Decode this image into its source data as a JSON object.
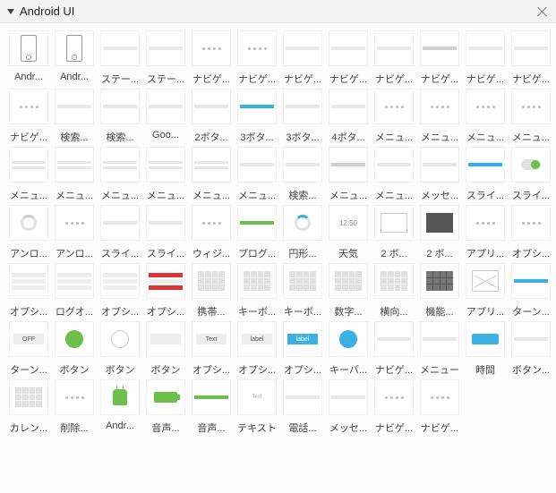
{
  "header": {
    "title": "Android UI"
  },
  "items": [
    {
      "label": "Andr...",
      "t": "phone"
    },
    {
      "label": "Andr...",
      "t": "phone"
    },
    {
      "label": "ステー...",
      "t": "bar"
    },
    {
      "label": "ステー...",
      "t": "bar"
    },
    {
      "label": "ナビゲ...",
      "t": "dots"
    },
    {
      "label": "ナビゲ...",
      "t": "dots"
    },
    {
      "label": "ナビゲ...",
      "t": "bar"
    },
    {
      "label": "ナビゲ...",
      "t": "bar"
    },
    {
      "label": "ナビゲ...",
      "t": "bar"
    },
    {
      "label": "ナビゲ...",
      "t": "bar-d"
    },
    {
      "label": "ナビゲ...",
      "t": "bar"
    },
    {
      "label": "ナビゲ...",
      "t": "bar"
    },
    {
      "label": "ナビゲ...",
      "t": "dots"
    },
    {
      "label": "検索...",
      "t": "bar"
    },
    {
      "label": "検索...",
      "t": "bar"
    },
    {
      "label": "Goo...",
      "t": "bar"
    },
    {
      "label": "2ボタ...",
      "t": "bar"
    },
    {
      "label": "3ボタ...",
      "t": "bar-b"
    },
    {
      "label": "3ボタ...",
      "t": "bar"
    },
    {
      "label": "4ボタ...",
      "t": "bar"
    },
    {
      "label": "メニュ...",
      "t": "dots"
    },
    {
      "label": "メニュ...",
      "t": "dots"
    },
    {
      "label": "メニュ...",
      "t": "dots"
    },
    {
      "label": "メニュ...",
      "t": "dots"
    },
    {
      "label": "メニュ...",
      "t": "2line"
    },
    {
      "label": "メニュ...",
      "t": "2line"
    },
    {
      "label": "メニュ...",
      "t": "2line"
    },
    {
      "label": "メニュ...",
      "t": "2line"
    },
    {
      "label": "メニュ...",
      "t": "2line"
    },
    {
      "label": "メニュ...",
      "t": "bar"
    },
    {
      "label": "検索...",
      "t": "bar"
    },
    {
      "label": "メニュ...",
      "t": "bar-d"
    },
    {
      "label": "メニュ...",
      "t": "bar"
    },
    {
      "label": "メッセ...",
      "t": "bar"
    },
    {
      "label": "スライ...",
      "t": "bar-b"
    },
    {
      "label": "スライ...",
      "t": "tog"
    },
    {
      "label": "アンロ...",
      "t": "ring-d"
    },
    {
      "label": "アンロ...",
      "t": "dots"
    },
    {
      "label": "スライ...",
      "t": "bar"
    },
    {
      "label": "スライ...",
      "t": "bar"
    },
    {
      "label": "ウィジ...",
      "t": "dots"
    },
    {
      "label": "プログ...",
      "t": "bar-g"
    },
    {
      "label": "円形...",
      "t": "ring"
    },
    {
      "label": "天気",
      "t": "time",
      "txt": "12:50"
    },
    {
      "label": "2 ボ...",
      "t": "box"
    },
    {
      "label": "2 ボ...",
      "t": "box-d"
    },
    {
      "label": "アプリ...",
      "t": "dots"
    },
    {
      "label": "オプシ...",
      "t": "dots"
    },
    {
      "label": "オプシ...",
      "t": "stack"
    },
    {
      "label": "ログオ...",
      "t": "stack"
    },
    {
      "label": "オプシ...",
      "t": "stack"
    },
    {
      "label": "オプシ...",
      "t": "stack-r"
    },
    {
      "label": "携帯...",
      "t": "grid"
    },
    {
      "label": "キーボ...",
      "t": "grid"
    },
    {
      "label": "キーボ...",
      "t": "grid"
    },
    {
      "label": "数字...",
      "t": "grid"
    },
    {
      "label": "横向...",
      "t": "grid"
    },
    {
      "label": "機能...",
      "t": "grid-d"
    },
    {
      "label": "アプリ...",
      "t": "x"
    },
    {
      "label": "ターン...",
      "t": "bar-b"
    },
    {
      "label": "ターン...",
      "t": "btn-gr",
      "txt": "OFF"
    },
    {
      "label": "ボタン",
      "t": "circ-g"
    },
    {
      "label": "ボタン",
      "t": "circ-w"
    },
    {
      "label": "ボタン",
      "t": "btn-gr",
      "txt": ""
    },
    {
      "label": "オプシ...",
      "t": "btn-gr",
      "txt": "Text"
    },
    {
      "label": "オプシ...",
      "t": "btn-gr",
      "txt": "label"
    },
    {
      "label": "オプシ...",
      "t": "btn-b",
      "txt": "label"
    },
    {
      "label": "キーパ...",
      "t": "circ-b"
    },
    {
      "label": "ナビゲ...",
      "t": "bar"
    },
    {
      "label": "メニュー",
      "t": "bar"
    },
    {
      "label": "時間",
      "t": "clk"
    },
    {
      "label": "ボタン...",
      "t": "bar"
    },
    {
      "label": "カレン...",
      "t": "grid"
    },
    {
      "label": "削除...",
      "t": "dots"
    },
    {
      "label": "Andr...",
      "t": "android"
    },
    {
      "label": "音声...",
      "t": "batt"
    },
    {
      "label": "音声...",
      "t": "bar-g"
    },
    {
      "label": "テキスト",
      "t": "txt",
      "txt": "Text"
    },
    {
      "label": "電話...",
      "t": "bar"
    },
    {
      "label": "メッセ...",
      "t": "bar"
    },
    {
      "label": "ナビゲ...",
      "t": "dots"
    },
    {
      "label": "ナビゲ...",
      "t": "dots"
    }
  ]
}
